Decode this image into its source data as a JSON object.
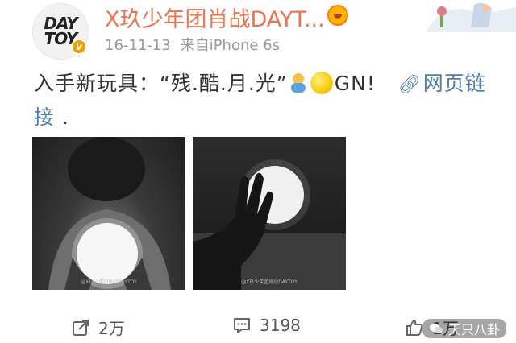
{
  "post": {
    "username": "X玖少年团肖战DAYT...",
    "avatar_text_line1": "DAY",
    "avatar_text_line2": "TOY",
    "verified_badge": "v",
    "date": "16-11-13",
    "source": "来自iPhone 6s",
    "text_before_emoji": "入手新玩具：“残.酷.月.光”",
    "text_after_emoji": "GN!",
    "link_label": "网页链接",
    "text_tail": " .",
    "photo_watermark_1": "@X玖少年团肖战DAYTOY",
    "photo_watermark_2": "@X玖少年团肖战DAYTOY"
  },
  "footer": {
    "repost_count": "2万",
    "comment_count": "3198",
    "like_count": "1万",
    "wechat_watermark": "天只八卦"
  },
  "colors": {
    "username": "#eb7350",
    "link": "#507daf",
    "meta": "#999999",
    "verified": "#f0a000"
  },
  "icons": {
    "repost": "repost-icon",
    "comment": "comment-icon",
    "like": "like-icon",
    "link": "link-icon",
    "vip": "vip-crown-icon"
  }
}
